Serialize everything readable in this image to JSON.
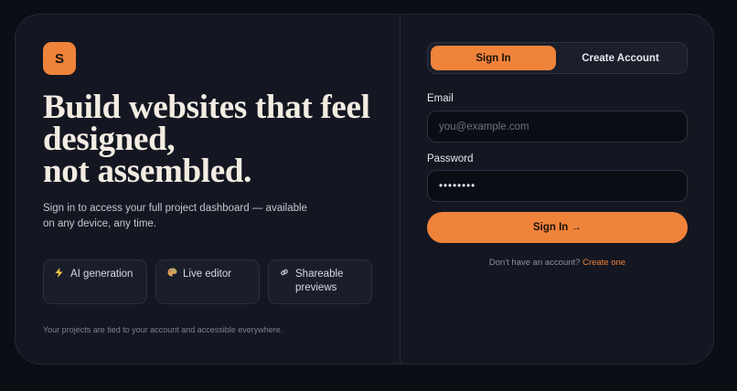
{
  "brand": {
    "logo_letter": "S",
    "accent": "#f0833a"
  },
  "hero": {
    "headline_lines": [
      "Build websites that feel",
      "designed,",
      "not assembled."
    ],
    "subtext": "Sign in to access your full project dashboard — available on any device, any time."
  },
  "features": [
    {
      "icon": "lightning-icon",
      "label": "AI generation"
    },
    {
      "icon": "palette-icon",
      "label": "Live editor"
    },
    {
      "icon": "link-icon",
      "label": "Shareable previews"
    }
  ],
  "footnote": "Your projects are tied to your account and accessible everywhere.",
  "auth": {
    "tabs": {
      "sign_in": "Sign In",
      "create_account": "Create Account",
      "active": "sign_in"
    },
    "email_label": "Email",
    "email_placeholder": "you@example.com",
    "email_value": "",
    "password_label": "Password",
    "password_value": "••••••••",
    "submit_label": "Sign In →",
    "alt_text": "Don't have an account?",
    "alt_link": "Create one"
  }
}
